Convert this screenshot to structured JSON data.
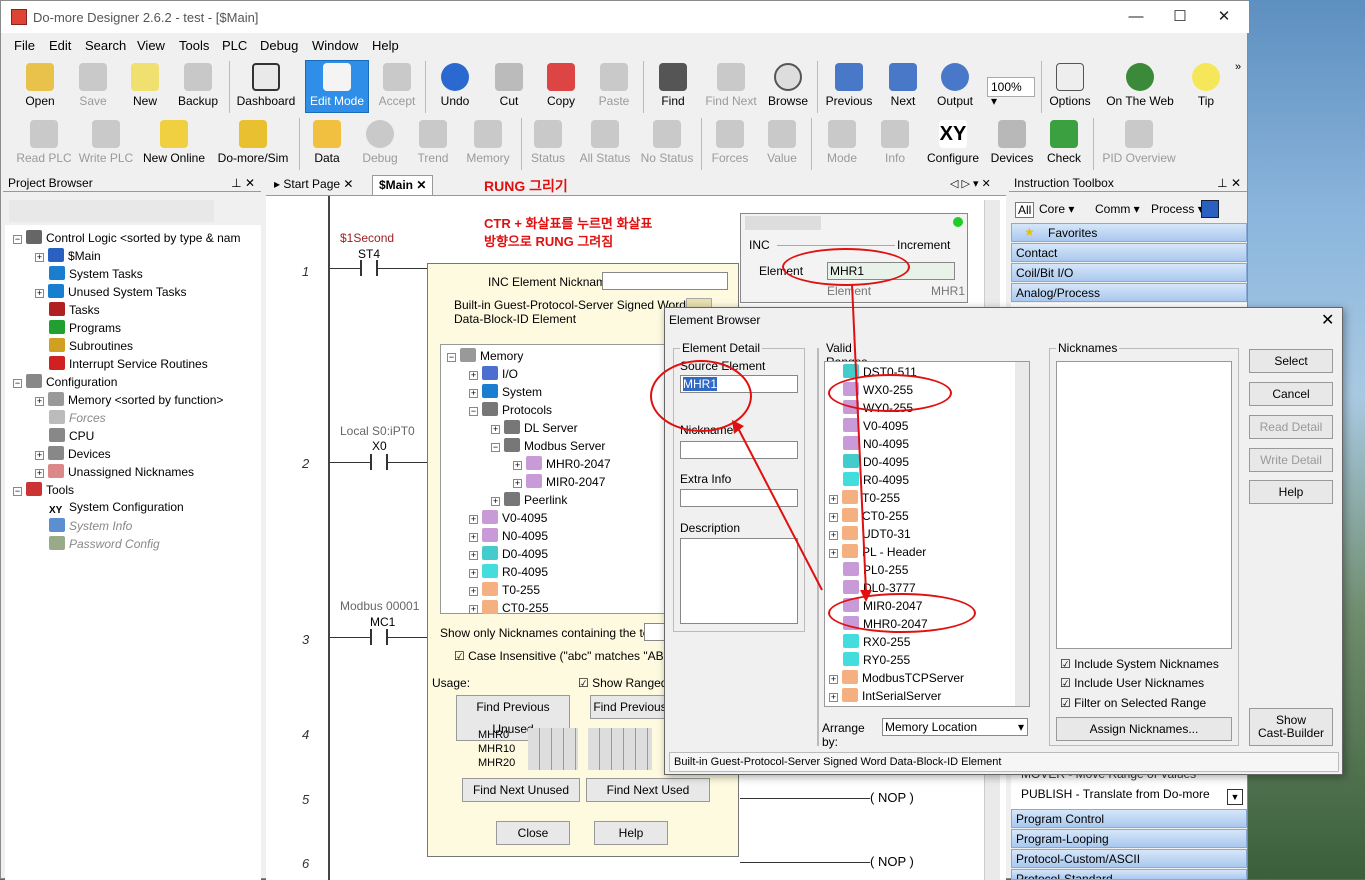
{
  "window": {
    "title": "Do-more Designer 2.6.2 - test - [$Main]",
    "min": "—",
    "max": "☐",
    "close": "✕"
  },
  "menu": [
    "File",
    "Edit",
    "Search",
    "View",
    "Tools",
    "PLC",
    "Debug",
    "Window",
    "Help"
  ],
  "toolbar1": [
    "Open",
    "Save",
    "New",
    "Backup",
    "Dashboard",
    "Edit Mode",
    "Accept",
    "Undo",
    "Cut",
    "Copy",
    "Paste",
    "Find",
    "Find Next",
    "Browse",
    "Previous",
    "Next",
    "Output",
    "100%",
    "Options",
    "On The Web",
    "Tip"
  ],
  "toolbar2": [
    "Read PLC",
    "Write PLC",
    "New Online",
    "Do-more/Sim",
    "Data",
    "Debug",
    "Trend",
    "Memory",
    "Status",
    "All Status",
    "No Status",
    "Forces",
    "Value",
    "Mode",
    "Info",
    "Configure",
    "Devices",
    "Check",
    "PID Overview"
  ],
  "project_browser": {
    "title": "Project Browser",
    "items": [
      "Control Logic <sorted by type & nam",
      "$Main",
      "System Tasks",
      "Unused System Tasks",
      "Tasks",
      "Programs",
      "Subroutines",
      "Interrupt Service Routines",
      "Configuration",
      "Memory <sorted by function>",
      "Forces",
      "CPU",
      "Devices",
      "Unassigned Nicknames",
      "Tools",
      "System Configuration",
      "System Info",
      "Password Config"
    ]
  },
  "tabs": {
    "start": "Start Page",
    "main": "$Main",
    "annotation": "RUNG 그리기"
  },
  "annotation2": "CTR + 화살표를 누르면 화살표\n방향으로 RUNG 그려짐",
  "ladder": {
    "rungs": [
      "1",
      "2",
      "3",
      "4",
      "5",
      "6"
    ],
    "r1_label": "$1Second",
    "r1_contact": "ST4",
    "r2_label": "Local S0:iPT0",
    "r2_contact": "X0",
    "r3_label": "Modbus 00001",
    "r3_contact": "MC1",
    "nop": "NOP"
  },
  "inc_box": {
    "inc": "INC",
    "increment": "Increment",
    "element_label": "Element",
    "element_value": "MHR1",
    "ghost_element": "Element",
    "ghost_value": "MHR1"
  },
  "mem_dialog": {
    "nick_label": "INC Element Nickname",
    "desc": "Built-in Guest-Protocol-Server Signed Word Data-Block-ID Element",
    "tree": [
      "Memory",
      "I/O",
      "System",
      "Protocols",
      "DL Server",
      "Modbus Server",
      "MHR0-2047",
      "MIR0-2047",
      "Peerlink",
      "V0-4095",
      "N0-4095",
      "D0-4095",
      "R0-4095",
      "T0-255",
      "CT0-255"
    ],
    "show_only": "Show only Nicknames containing the text",
    "case": "Case Insensitive (\"abc\" matches \"ABC\" or",
    "usage": "Usage:",
    "show_ranged": "Show Ranged F",
    "find_prev_unused": "Find Previous Unused",
    "find_prev_used": "Find Previous",
    "rows": [
      "MHR0",
      "MHR10",
      "MHR20"
    ],
    "find_next_unused": "Find Next Unused",
    "find_next_used": "Find Next Used",
    "close": "Close",
    "help": "Help"
  },
  "element_browser": {
    "title": "Element Browser",
    "detail": "Element Detail",
    "source": "Source Element",
    "source_value": "MHR1",
    "nickname": "Nickname",
    "extra": "Extra Info",
    "description": "Description",
    "valid": "Valid Ranges",
    "ranges": [
      "DST0-511",
      "WX0-255",
      "WY0-255",
      "V0-4095",
      "N0-4095",
      "D0-4095",
      "R0-4095",
      "T0-255",
      "CT0-255",
      "UDT0-31",
      "PL - Header",
      "PL0-255",
      "DL0-3777",
      "MIR0-2047",
      "MHR0-2047",
      "RX0-255",
      "RY0-255",
      "ModbusTCPServer",
      "IntSerialServer"
    ],
    "arrange": "Arrange by:",
    "arrange_value": "Memory Location",
    "nicknames": "Nicknames",
    "inc_sys": "Include System Nicknames",
    "inc_user": "Include User Nicknames",
    "filter": "Filter on Selected Range",
    "assign": "Assign Nicknames...",
    "select": "Select",
    "cancel": "Cancel",
    "read": "Read Detail",
    "write": "Write Detail",
    "help": "Help",
    "cast": "Show\nCast-Builder",
    "status": "Built-in Guest-Protocol-Server Signed Word Data-Block-ID Element"
  },
  "toolbox": {
    "title": "Instruction Toolbox",
    "filters": [
      "All",
      "Core",
      "Comm",
      "Process"
    ],
    "cats": [
      "Favorites",
      "Contact",
      "Coil/Bit I/O",
      "Analog/Process"
    ],
    "lower": [
      "MOVER - Move Range of Values",
      "PUBLISH - Translate from Do-more"
    ],
    "cats2": [
      "Program Control",
      "Program-Looping",
      "Protocol-Custom/ASCII",
      "Protocol-Standard"
    ]
  }
}
